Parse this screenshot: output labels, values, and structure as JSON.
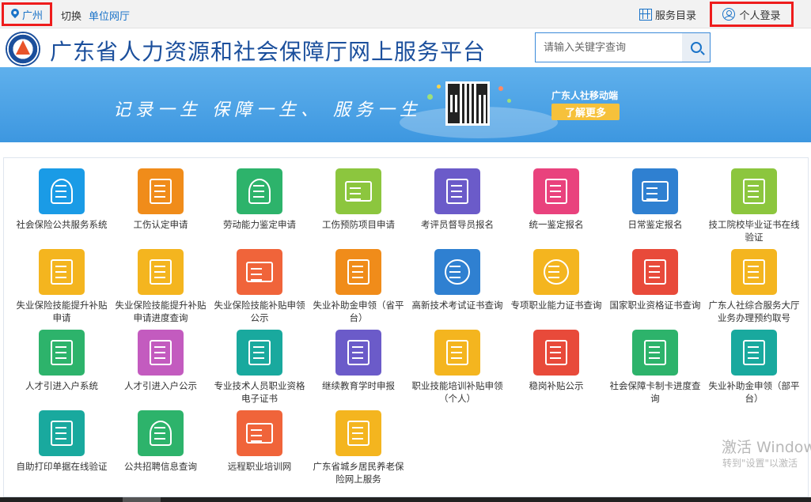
{
  "topbar": {
    "city": "广州",
    "switch_label": "切换",
    "unit_hall": "单位网厅",
    "service_directory": "服务目录",
    "login": "个人登录"
  },
  "header": {
    "site_title": "广东省人力资源和社会保障厅网上服务平台",
    "search_placeholder": "请输入关键字查询"
  },
  "banner": {
    "slogan": "记录一生  保障一生、 服务一生",
    "mobile_title": "广东人社移动端",
    "more_button": "了解更多"
  },
  "services": [
    {
      "label": "社会保险公共服务系统",
      "color": "#1a9be6"
    },
    {
      "label": "工伤认定申请",
      "color": "#f08c1a"
    },
    {
      "label": "劳动能力鉴定申请",
      "color": "#2db36b"
    },
    {
      "label": "工伤预防项目申请",
      "color": "#8cc63e"
    },
    {
      "label": "考评员督导员报名",
      "color": "#6b5bc9"
    },
    {
      "label": "统一鉴定报名",
      "color": "#e9427d"
    },
    {
      "label": "日常鉴定报名",
      "color": "#2f80d1"
    },
    {
      "label": "技工院校毕业证书在线验证",
      "color": "#8cc63e"
    },
    {
      "label": "失业保险技能提升补贴申请",
      "color": "#f4b51f"
    },
    {
      "label": "失业保险技能提升补贴申请进度查询",
      "color": "#f4b51f"
    },
    {
      "label": "失业保险技能补贴申领公示",
      "color": "#f0643a"
    },
    {
      "label": "失业补助金申领（省平台）",
      "color": "#f08c1a"
    },
    {
      "label": "高新技术考试证书查询",
      "color": "#2f80d1"
    },
    {
      "label": "专项职业能力证书查询",
      "color": "#f4b51f"
    },
    {
      "label": "国家职业资格证书查询",
      "color": "#e84a3a"
    },
    {
      "label": "广东人社综合服务大厅业务办理预约取号",
      "color": "#f4b51f"
    },
    {
      "label": "人才引进入户系统",
      "color": "#2db36b"
    },
    {
      "label": "人才引进入户公示",
      "color": "#c35bbf"
    },
    {
      "label": "专业技术人员职业资格电子证书",
      "color": "#19a99e"
    },
    {
      "label": "继续教育学时申报",
      "color": "#6b5bc9"
    },
    {
      "label": "职业技能培训补贴申领（个人）",
      "color": "#f4b51f"
    },
    {
      "label": "稳岗补贴公示",
      "color": "#e84a3a"
    },
    {
      "label": "社会保障卡制卡进度查询",
      "color": "#2db36b"
    },
    {
      "label": "失业补助金申领（部平台）",
      "color": "#19a99e"
    },
    {
      "label": "自助打印单据在线验证",
      "color": "#19a99e"
    },
    {
      "label": "公共招聘信息查询",
      "color": "#2db36b"
    },
    {
      "label": "远程职业培训网",
      "color": "#f0643a"
    },
    {
      "label": "广东省城乡居民养老保险网上服务",
      "color": "#f4b51f"
    }
  ],
  "watermark": {
    "line1": "激活 Window",
    "line2": "转到\"设置\"以激活"
  }
}
